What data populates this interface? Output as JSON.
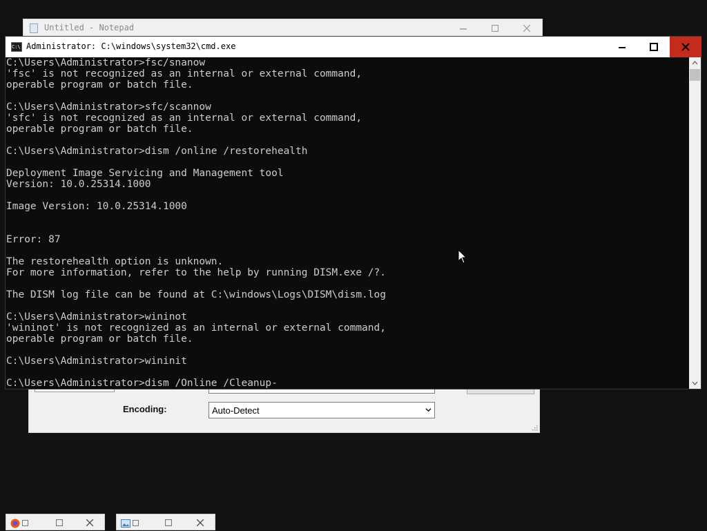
{
  "notepad": {
    "title": "Untitled - Notepad",
    "buttons": {
      "minimize_icon": "minimize-icon",
      "maximize_icon": "maximize-icon",
      "close_icon": "close-icon"
    }
  },
  "cmd": {
    "title": "Administrator: C:\\windows\\system32\\cmd.exe",
    "lines": [
      "C:\\Users\\Administrator>fsc/snanow",
      "'fsc' is not recognized as an internal or external command,",
      "operable program or batch file.",
      "",
      "C:\\Users\\Administrator>sfc/scannow",
      "'sfc' is not recognized as an internal or external command,",
      "operable program or batch file.",
      "",
      "C:\\Users\\Administrator>dism /online /restorehealth",
      "",
      "Deployment Image Servicing and Management tool",
      "Version: 10.0.25314.1000",
      "",
      "Image Version: 10.0.25314.1000",
      "",
      "",
      "Error: 87",
      "",
      "The restorehealth option is unknown.",
      "For more information, refer to the help by running DISM.exe /?.",
      "",
      "The DISM log file can be found at C:\\windows\\Logs\\DISM\\dism.log",
      "",
      "C:\\Users\\Administrator>wininot",
      "'wininot' is not recognized as an internal or external command,",
      "operable program or batch file.",
      "",
      "C:\\Users\\Administrator>wininit",
      "",
      "C:\\Users\\Administrator>dism /Online /Cleanup-"
    ],
    "colors": {
      "background": "#0c0c0c",
      "text": "#cccccc",
      "close_button": "#c42b1c"
    }
  },
  "dialog": {
    "encoding_label": "Encoding:",
    "encoding_value": "Auto-Detect"
  },
  "taskbar": {
    "thumbnails": [
      {
        "name": "firefox-window-thumbnail",
        "icon": "firefox-icon"
      },
      {
        "name": "image-viewer-window-thumbnail",
        "icon": "image-icon"
      }
    ]
  }
}
